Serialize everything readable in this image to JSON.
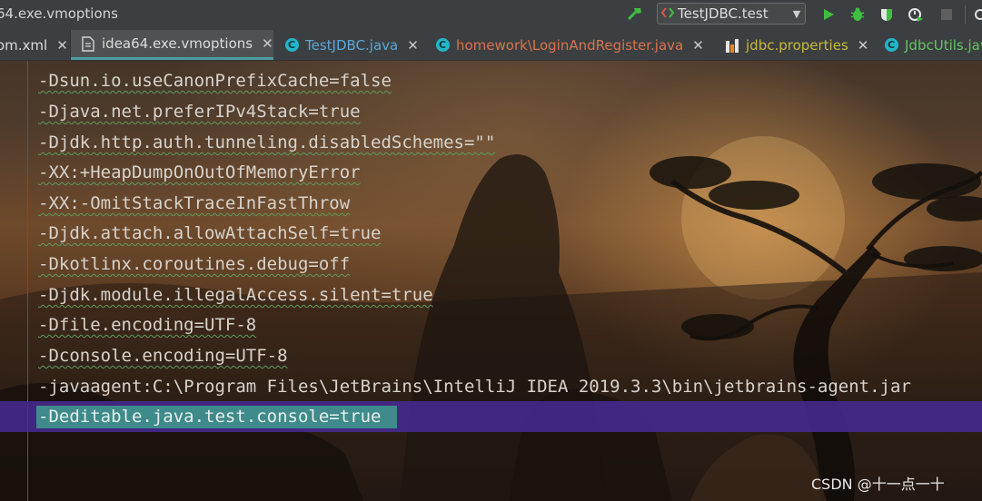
{
  "window": {
    "title": "64.exe.vmoptions"
  },
  "toolbar": {
    "run_config_label": "TestJDBC.test",
    "icons": [
      "hammer-icon",
      "run-config-icon",
      "chevron-down-icon",
      "run-icon",
      "debug-icon",
      "coverage-icon",
      "profile-icon",
      "stop-icon",
      "search-icon"
    ]
  },
  "tabs": [
    {
      "label": "om.xml",
      "icon": "xml-file-icon",
      "color": "#dcdcdc",
      "active": false
    },
    {
      "label": "idea64.exe.vmoptions",
      "icon": "file-icon",
      "color": "#dcdcdc",
      "active": true
    },
    {
      "label": "TestJDBC.java",
      "icon": "class-icon",
      "color": "#5aa8d6",
      "active": false
    },
    {
      "label": "homework\\LoginAndRegister.java",
      "icon": "class-icon",
      "color": "#d9734c",
      "active": false
    },
    {
      "label": "jdbc.properties",
      "icon": "properties-file-icon",
      "color": "#c9b93a",
      "active": false
    },
    {
      "label": "JdbcUtils.jav",
      "icon": "class-icon",
      "color": "#62c462",
      "active": false
    }
  ],
  "editor": {
    "lines": [
      "-Dsun.io.useCanonPrefixCache=false",
      "-Djava.net.preferIPv4Stack=true",
      "-Djdk.http.auth.tunneling.disabledSchemes=\"\"",
      "-XX:+HeapDumpOnOutOfMemoryError",
      "-XX:-OmitStackTraceInFastThrow",
      "-Djdk.attach.allowAttachSelf=true",
      "-Dkotlinx.coroutines.debug=off",
      "-Djdk.module.illegalAccess.silent=true",
      "-Dfile.encoding=UTF-8",
      "-Dconsole.encoding=UTF-8",
      "-javaagent:C:\\Program Files\\JetBrains\\IntelliJ IDEA 2019.3.3\\bin\\jetbrains-agent.jar",
      "-Deditable.java.test.console=true"
    ],
    "selected_line": "-Deditable.java.test.console=true"
  },
  "watermark": "CSDN @十一点一十",
  "colors": {
    "accent_tab_underline": "#4a9ea0",
    "current_line": "#482a96",
    "selection": "#3f8a8a",
    "run_green": "#3fbf3f"
  }
}
